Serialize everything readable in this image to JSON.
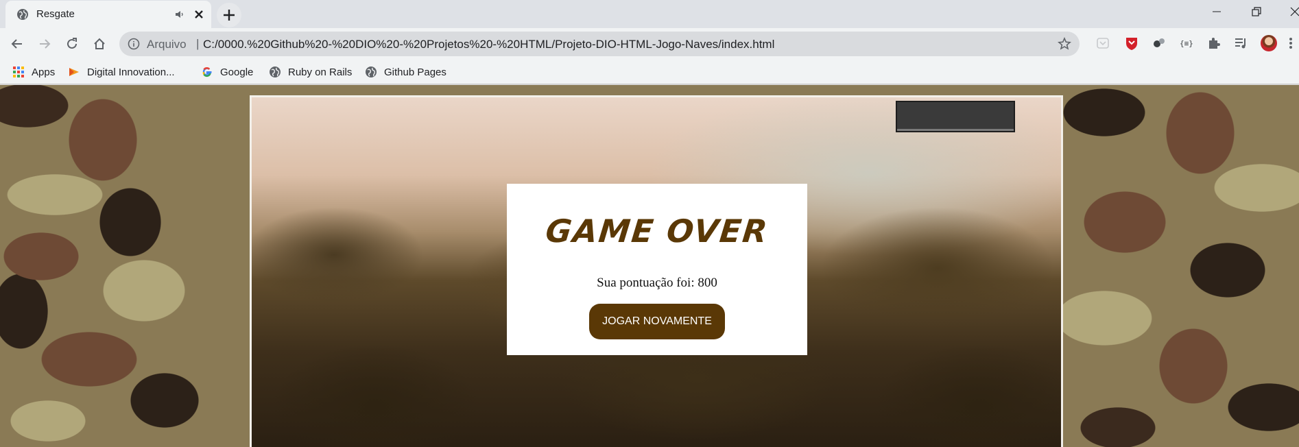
{
  "tab": {
    "title": "Resgate"
  },
  "omnibox": {
    "scheme_label": "Arquivo",
    "separator": "|",
    "url": "C:/0000.%20Github%20-%20DIO%20-%20Projetos%20-%20HTML/Projeto-DIO-HTML-Jogo-Naves/index.html"
  },
  "bookmarks": [
    {
      "label": "Apps",
      "icon": "apps-grid-icon"
    },
    {
      "label": "Digital Innovation...",
      "icon": "dio-logo-icon"
    },
    {
      "label": "Google",
      "icon": "google-icon"
    },
    {
      "label": "Ruby on Rails",
      "icon": "globe-icon"
    },
    {
      "label": "Github Pages",
      "icon": "globe-icon"
    }
  ],
  "game": {
    "title": "GAME OVER",
    "score_text": "Sua pontuação foi: 800",
    "replay_label": "JOGAR NOVAMENTE"
  },
  "colors": {
    "accent_brown": "#5a3806",
    "chrome_bg": "#dee1e6",
    "toolbar_bg": "#f1f3f4"
  }
}
